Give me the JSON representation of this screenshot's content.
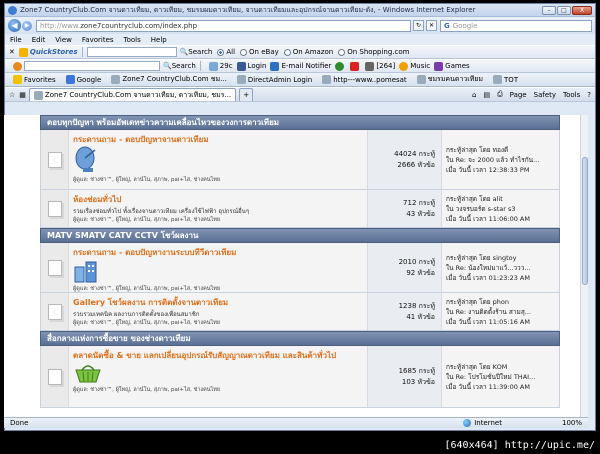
{
  "window": {
    "title": "Zone7 CountryClub.Com จานดาวเทียม, ดาวเทียม, ชมรมผมดาวเทียม, จานดาวเทียมและอุปกรณ์จานดาวเทียม-ดัง, - Windows Internet Explorer",
    "minimize": "–",
    "maximize": "□",
    "close": "X"
  },
  "address": {
    "prefix": "http://www.",
    "rest": "zone7countryclub.com/index.php",
    "search_placeholder": "Google"
  },
  "menubar": [
    "File",
    "Edit",
    "View",
    "Favorites",
    "Tools",
    "Help"
  ],
  "quickstores": {
    "brand": "QuickStores",
    "search": "Search",
    "options": [
      "All",
      "On eBay",
      "On Amazon",
      "On Shopping.com"
    ]
  },
  "toolbar2": {
    "search": "Search",
    "weather": "29c",
    "login": "Login",
    "email": "E-mail Notifier",
    "count": "[264]",
    "music": "Music",
    "games": "Games"
  },
  "favbar": {
    "favorites": "Favorites",
    "items": [
      "Google",
      "Zone7 CountryClub.Com ชม...",
      "DirectAdmin Login",
      "http---www..pomesat",
      "ชมรมคนดาวเทียม",
      "TOT"
    ]
  },
  "tab": {
    "label": "Zone7 CountryClub.Com จานดาวเทียม, ดาวเทียม, ชมร..."
  },
  "commandbar": [
    "Page",
    "Safety",
    "Tools"
  ],
  "categories": [
    {
      "title": "ตอบทุกปัญหา พร้อมอัพเดทข่าวความเคลื่อนไหวของวงการดาวเทียม",
      "forums": [
        {
          "title": "กระดานถาม - ตอบปัญหาจานดาวเทียม",
          "desc": "",
          "mods": "ผู้ดูแล: ช่างซ่า™, ผู้ใหญ่, ลาน์โน, สุภาพ, pai+ไส, ช่างคนไทย",
          "posts": "44024 กระทู้",
          "topics": "2666 หัวข้อ",
          "lp_by": "กระทู้ล่าสุด โดย ทองดี",
          "lp_in": "ใน Re: จะ 2000 แล้ว ทำไรกัน...",
          "lp_time": "เมื่อ วันนี้ เวลา 12:38:33 PM"
        },
        {
          "title": "ห้องช่อมทั่วไป",
          "desc": "รวมเรื่องซ่อมทั่วไป ทั้งเรื่องจานดาวเทียม เครื่องใช้ไฟฟ้า อุปกรณ์อื่นๆ",
          "mods": "ผู้ดูแล: ช่างซ่า™, ผู้ใหญ่, ลาน์โน, สุภาพ, pai+ไส, ช่างคนไทย",
          "posts": "712 กระทู้",
          "topics": "43 หัวข้อ",
          "lp_by": "กระทู้ล่าสุด โดย alit",
          "lp_in": "ใน วงจรบอร์ด s-star s3",
          "lp_time": "เมื่อ วันนี้ เวลา 11:06:00 AM"
        }
      ]
    },
    {
      "title": "MATV SMATV CATV CCTV โชว์ผลงาน",
      "forums": [
        {
          "title": "กระดานถาม - ตอบปัญหางานระบบทีวีดาวเทียม",
          "desc": "",
          "mods": "ผู้ดูแล: ช่างซ่า™, ผู้ใหญ่, ลาน์โน, สุภาพ, pai+ไส, ช่างคนไทย",
          "posts": "2010 กระทู้",
          "topics": "92 หัวข้อ",
          "lp_by": "กระทู้ล่าสุด โดย singtoy",
          "lp_in": "ใน Re: น้องใหม่มาแว้...ววว...",
          "lp_time": "เมื่อ วันนี้ เวลา 01:23:23 AM"
        },
        {
          "title": "Gallery โชว์ผลงาน การติดตั้งจานดาวเทียม",
          "desc": "รวบรวมเทคนิค ผลงานการติดตั้งของเพื่อนสมาชิก",
          "mods": "ผู้ดูแล: ช่างซ่า™, ผู้ใหญ่, ลาน์โน, สุภาพ, pai+ไส, ช่างคนไทย",
          "posts": "1238 กระทู้",
          "topics": "41 หัวข้อ",
          "lp_by": "กระทู้ล่าสุด โดย phon",
          "lp_in": "ใน Re: งานติดตั้งร้าน สามสุ...",
          "lp_time": "เมื่อ วันนี้ เวลา 11:05:16 AM"
        }
      ]
    },
    {
      "title": "สื่อกลางแห่งการซื้อขาย ของช่างดาวเทียม",
      "forums": [
        {
          "title": "ตลาดนัดซื้อ & ขาย แลกเปลี่ยนอุปกรณ์รับสัญญาณดาวเทียม และสินค้าทั่วไป",
          "desc": "",
          "mods": "ผู้ดูแล: ช่างซ่า™, ผู้ใหญ่, ลาน์โน, สุภาพ, pai+ไส, ช่างคนไทย",
          "posts": "1685 กระทู้",
          "topics": "103 หัวข้อ",
          "lp_by": "กระทู้ล่าสุด โดย KOM",
          "lp_in": "ใน Re: โปรโมชั่นปีใหม่ THAI...",
          "lp_time": "เมื่อ วันนี้ เวลา 11:39:00 AM"
        }
      ]
    }
  ],
  "status": {
    "done": "Done",
    "zone": "Internet",
    "zoom": "100%"
  },
  "watermark": "[640x464] http://upic.me/"
}
